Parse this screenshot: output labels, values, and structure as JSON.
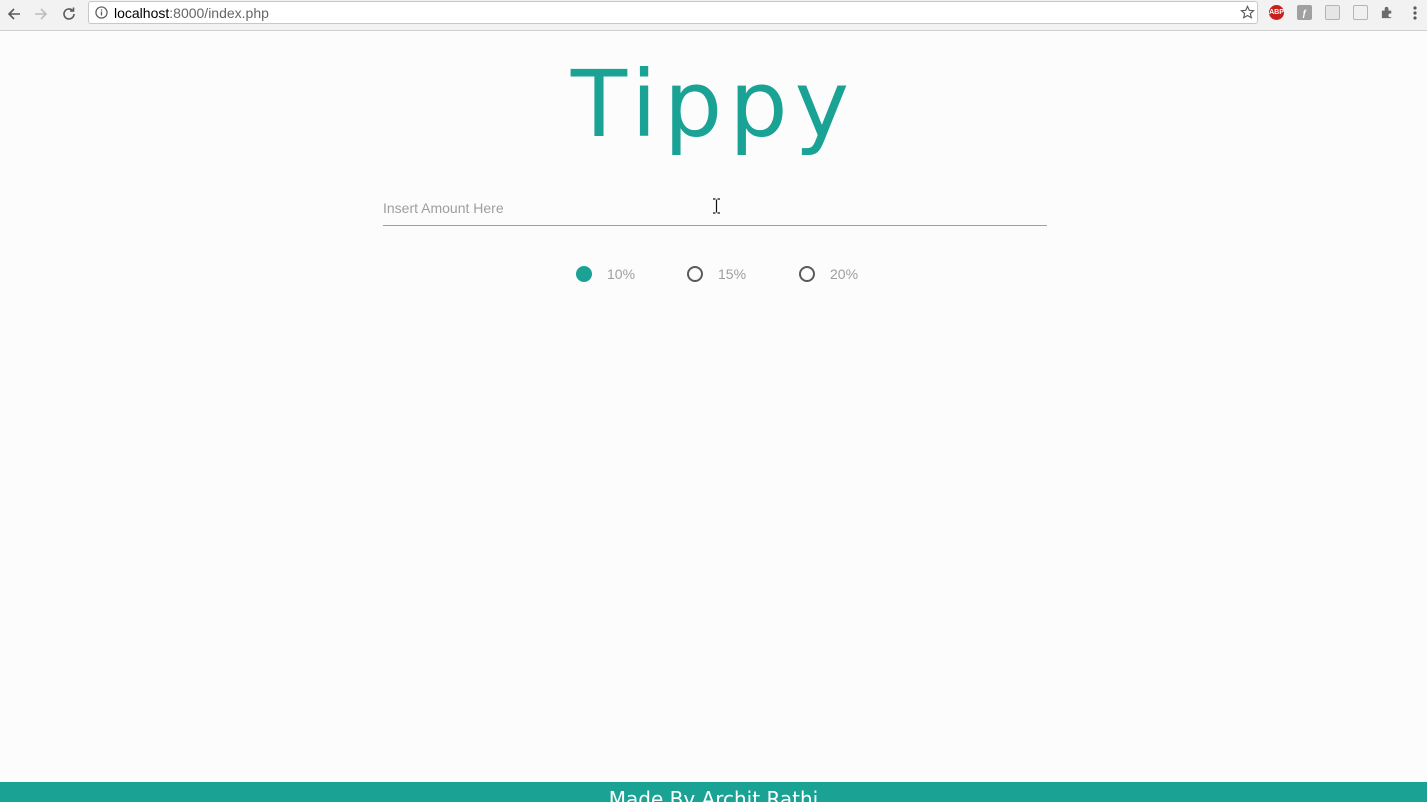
{
  "browser": {
    "url_host": "localhost",
    "url_rest": ":8000/index.php",
    "extensions": {
      "abp_label": "ABP"
    }
  },
  "page": {
    "title": "Tippy",
    "amount_input": {
      "placeholder": "Insert Amount Here",
      "value": ""
    },
    "tip_options": [
      {
        "label": "10%",
        "selected": true
      },
      {
        "label": "15%",
        "selected": false
      },
      {
        "label": "20%",
        "selected": false
      }
    ],
    "footer": "Made By Archit Rathi"
  },
  "colors": {
    "accent": "#1aa295",
    "background": "#fcfcfc",
    "placeholder_text": "#9e9e9e"
  }
}
